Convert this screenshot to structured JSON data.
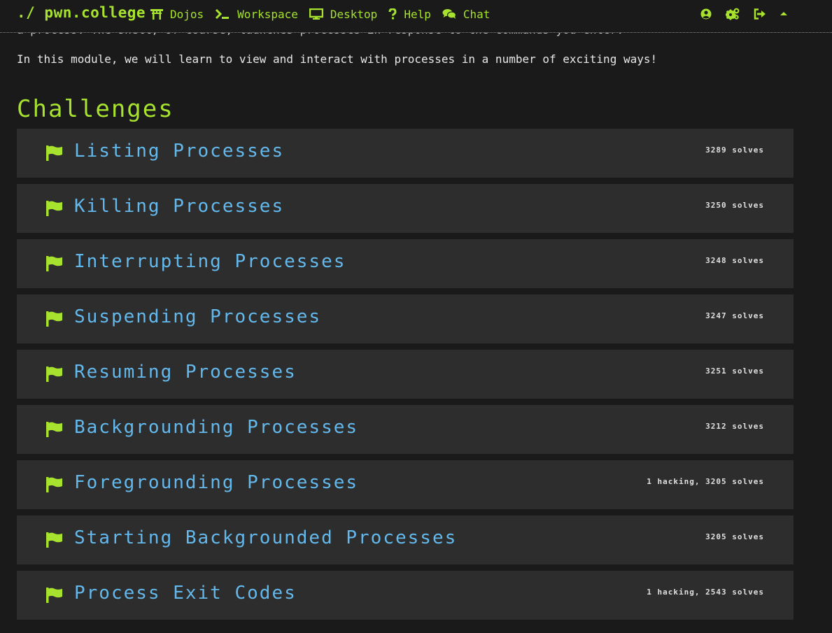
{
  "brand": "./ pwn.college",
  "nav": {
    "dojos": "Dojos",
    "workspace": "Workspace",
    "desktop": "Desktop",
    "help": "Help",
    "chat": "Chat"
  },
  "colors": {
    "accent": "#a6e22e",
    "link": "#63b8ec",
    "card_bg": "#2d2d2d",
    "page_bg": "#1a1a1a"
  },
  "partial_text": "a process. The shell, of course, launches processes in response to the commands you enter.",
  "intro": "In this module, we will learn to view and interact with processes in a number of exciting ways!",
  "heading": "Challenges",
  "challenges": [
    {
      "title": "Listing Processes",
      "solves": "3289 solves"
    },
    {
      "title": "Killing Processes",
      "solves": "3250 solves"
    },
    {
      "title": "Interrupting Processes",
      "solves": "3248 solves"
    },
    {
      "title": "Suspending Processes",
      "solves": "3247 solves"
    },
    {
      "title": "Resuming Processes",
      "solves": "3251 solves"
    },
    {
      "title": "Backgrounding Processes",
      "solves": "3212 solves"
    },
    {
      "title": "Foregrounding Processes",
      "solves": "1 hacking, 3205 solves"
    },
    {
      "title": "Starting Backgrounded Processes",
      "solves": "3205 solves"
    },
    {
      "title": "Process Exit Codes",
      "solves": "1 hacking, 2543 solves"
    }
  ]
}
